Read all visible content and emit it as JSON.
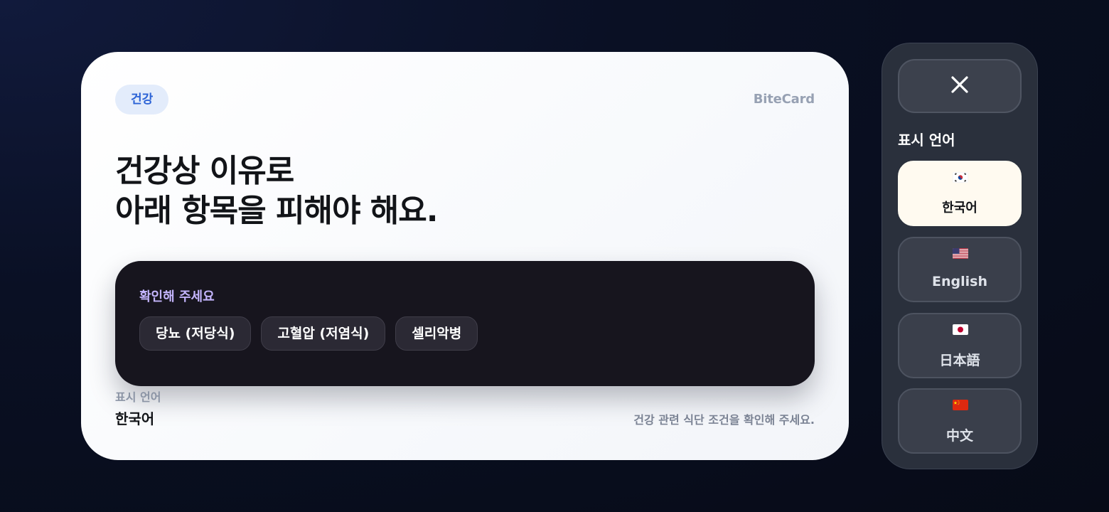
{
  "card": {
    "tag": "건강",
    "brand": "BiteCard",
    "headline_line1": "건강상 이유로",
    "headline_line2": "아래 항목을 피해야 해요.",
    "notice": {
      "title": "확인해 주세요",
      "chips": [
        "당뇨 (저당식)",
        "고혈압 (저염식)",
        "셀리악병"
      ]
    },
    "language_caption": "표시 언어",
    "language_value": "한국어",
    "footnote": "건강 관련 식단 조건을 확인해 주세요."
  },
  "panel": {
    "close_icon": "close-icon",
    "title": "표시 언어",
    "languages": [
      {
        "label": "한국어",
        "flag": "kr-flag-icon",
        "selected": true
      },
      {
        "label": "English",
        "flag": "us-flag-icon",
        "selected": false
      },
      {
        "label": "日本語",
        "flag": "jp-flag-icon",
        "selected": false
      },
      {
        "label": "中文",
        "flag": "cn-flag-icon",
        "selected": false
      }
    ]
  },
  "colors": {
    "tag_bg": "#e3ecfb",
    "tag_text": "#2c63d6",
    "notice_bg": "#17151e",
    "notice_title": "#c4b5fd",
    "panel_bg": "#2a303c",
    "selected_option_bg": "#fffaf0"
  }
}
